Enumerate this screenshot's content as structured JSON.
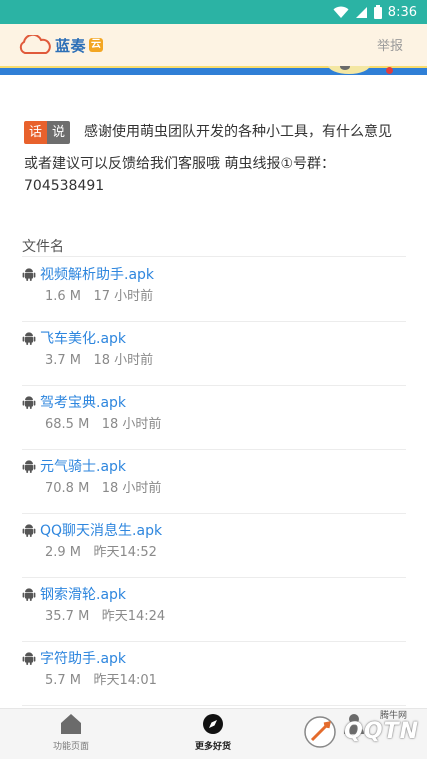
{
  "status_bar": {
    "time": "8:36"
  },
  "header": {
    "logo_text": "蓝奏",
    "logo_badge": "云",
    "report_label": "举报"
  },
  "notice": {
    "tag_first": "话",
    "tag_second": "说",
    "text": "感谢使用萌虫团队开发的各种小工具，有什么意见或者建议可以反馈给我们客服哦 萌虫线报①号群：",
    "group_number": "704538491"
  },
  "file_list": {
    "header": "文件名",
    "items": [
      {
        "name": "视频解析助手.apk",
        "size": "1.6 M",
        "time": "17 小时前"
      },
      {
        "name": "飞车美化.apk",
        "size": "3.7 M",
        "time": "18 小时前"
      },
      {
        "name": "驾考宝典.apk",
        "size": "68.5 M",
        "time": "18 小时前"
      },
      {
        "name": "元气骑士.apk",
        "size": "70.8 M",
        "time": "18 小时前"
      },
      {
        "name": "QQ聊天消息生.apk",
        "size": "2.9 M",
        "time": "昨天14:52"
      },
      {
        "name": "钢索滑轮.apk",
        "size": "35.7 M",
        "time": "昨天14:24"
      },
      {
        "name": "字符助手.apk",
        "size": "5.7 M",
        "time": "昨天14:01"
      }
    ]
  },
  "bottom_nav": {
    "items": [
      {
        "label": "功能页面",
        "icon": "home-icon"
      },
      {
        "label": "更多好货",
        "icon": "compass-icon"
      },
      {
        "label": "",
        "icon": "user-icon"
      }
    ]
  },
  "watermark": {
    "text": "QQTN",
    "sub": "腾牛网"
  },
  "colors": {
    "status_bar": "#2bb3a4",
    "link": "#2e86de",
    "tag_orange": "#e8612c",
    "tag_gray": "#6e6e6e"
  }
}
